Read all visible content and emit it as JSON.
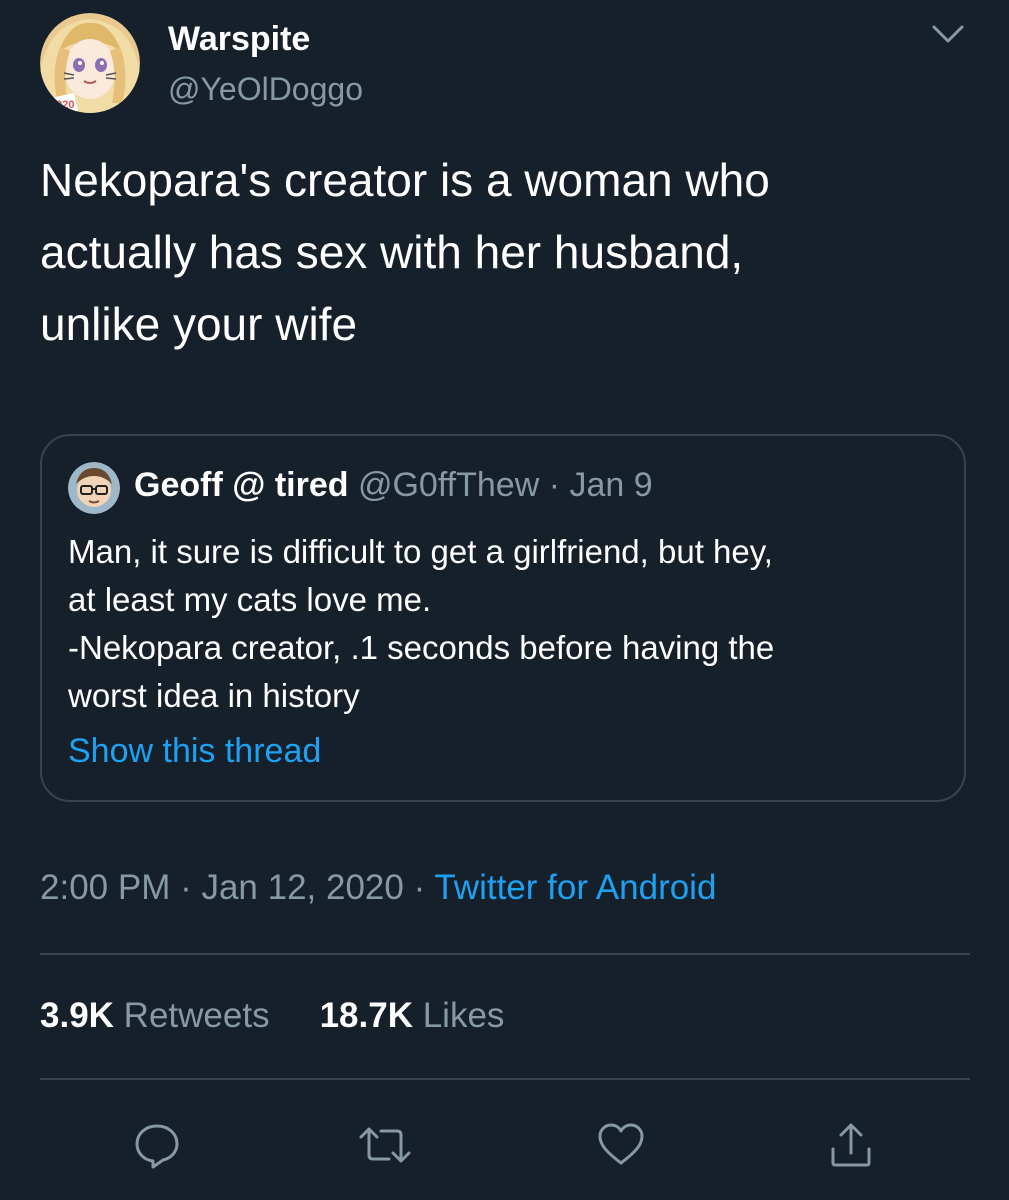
{
  "tweet": {
    "display_name": "Warspite",
    "handle": "@YeOlDoggo",
    "avatar_badge": "2020",
    "text": "Nekopara's creator is a woman who\nactually has sex with her husband,\nunlike your wife",
    "icons": {
      "menu": "chevron-down-icon"
    }
  },
  "quote": {
    "display_name": "Geoff @ tired",
    "handle": "@G0ffThew",
    "separator": " · ",
    "date": "Jan 9",
    "text": "Man, it sure is difficult to get a girlfriend, but hey,\nat least my cats love me.\n-Nekopara creator, .1 seconds before having the\nworst idea in history",
    "show_thread_label": "Show this thread"
  },
  "meta": {
    "time": "2:00 PM",
    "separator": " · ",
    "date": "Jan 12, 2020",
    "source": "Twitter for Android"
  },
  "stats": {
    "retweets_count": "3.9K",
    "retweets_label": "Retweets",
    "likes_count": "18.7K",
    "likes_label": "Likes"
  },
  "actions": [
    "reply-icon",
    "retweet-icon",
    "like-icon",
    "share-icon"
  ],
  "colors": {
    "background": "#15202b",
    "text": "#ffffff",
    "secondary": "#8899a6",
    "accent": "#1da1f2",
    "border": "#38444d"
  }
}
